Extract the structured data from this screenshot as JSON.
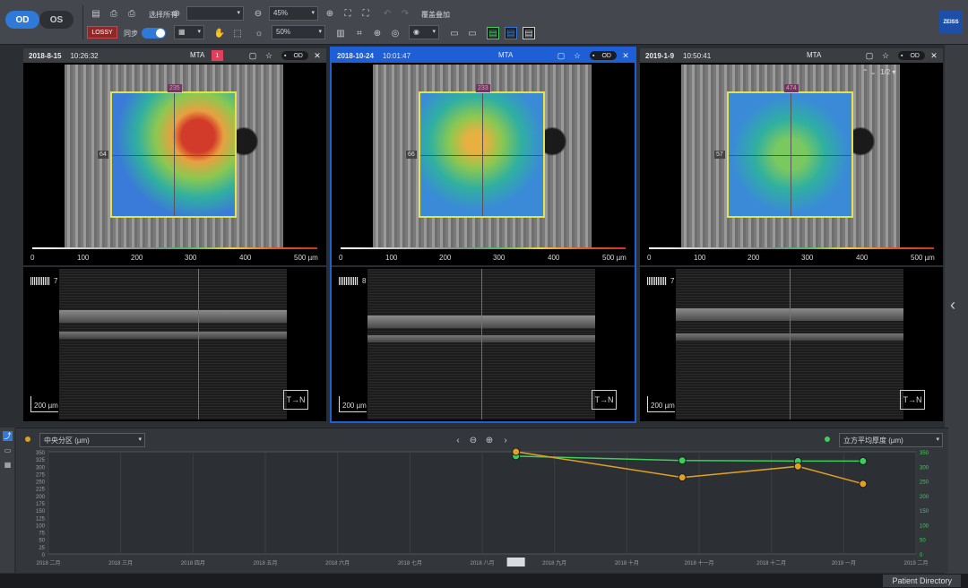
{
  "toolbar": {
    "eye_od": "OD",
    "eye_os": "OS",
    "eye_od_icon": "eye-toggle",
    "select_all": "选择所有",
    "zoom_value": "45%",
    "zoom_value2": "50%",
    "sync_label": "同步",
    "overlay_label": "覆盖叠加",
    "lossy_label": "LOSSY",
    "brand": "ZEISS"
  },
  "panels": [
    {
      "date": "2018-8-15",
      "time": "10:26:32",
      "mta": "MTA",
      "badge": "1",
      "eye": "OD",
      "top_val": "235",
      "left_val": "64",
      "bscan": "7",
      "scale": "200 µm",
      "active": false,
      "pager": ""
    },
    {
      "date": "2018-10-24",
      "time": "10:01:47",
      "mta": "MTA",
      "badge": "",
      "eye": "OD",
      "top_val": "233",
      "left_val": "66",
      "bscan": "8",
      "scale": "200 µm",
      "active": true,
      "pager": ""
    },
    {
      "date": "2019-1-9",
      "time": "10:50:41",
      "mta": "MTA",
      "badge": "",
      "eye": "OD",
      "top_val": "474",
      "left_val": "57",
      "bscan": "7",
      "scale": "200 µm",
      "active": false,
      "pager": "1/2"
    }
  ],
  "color_scale": [
    "0",
    "100",
    "200",
    "300",
    "400",
    "500 µm"
  ],
  "trend": {
    "left_select": "中央分区 (µm)",
    "right_select": "立方平均厚度 (µm)",
    "left_dot_color": "#e0a020",
    "right_dot_color": "#3ad05a",
    "y_ticks": [
      "350",
      "325",
      "300",
      "275",
      "250",
      "225",
      "200",
      "175",
      "150",
      "125",
      "100",
      "75",
      "50",
      "25",
      "0"
    ],
    "y_right_ticks": [
      "350",
      "300",
      "250",
      "200",
      "150",
      "100",
      "50",
      "0"
    ],
    "x_ticks": [
      "2018 二月",
      "2018 三月",
      "2018 四月",
      "2018 五月",
      "2018 六月",
      "2018 七月",
      "2018 八月",
      "2018 九月",
      "2018 十月",
      "2018 十一月",
      "2018 十二月",
      "2019 一月",
      "2019 二月"
    ],
    "dates": [
      "2018-8-15",
      "2018-10-24",
      "2018-12-12",
      "2019-1-9"
    ],
    "series": [
      {
        "color": "#3ad05a",
        "values": [
          335,
          320,
          318,
          318
        ]
      },
      {
        "color": "#e0a020",
        "values": [
          350,
          262,
          300,
          240
        ]
      }
    ],
    "marker_label": "2018-8-15"
  },
  "status": {
    "patient_directory": "Patient Directory"
  }
}
